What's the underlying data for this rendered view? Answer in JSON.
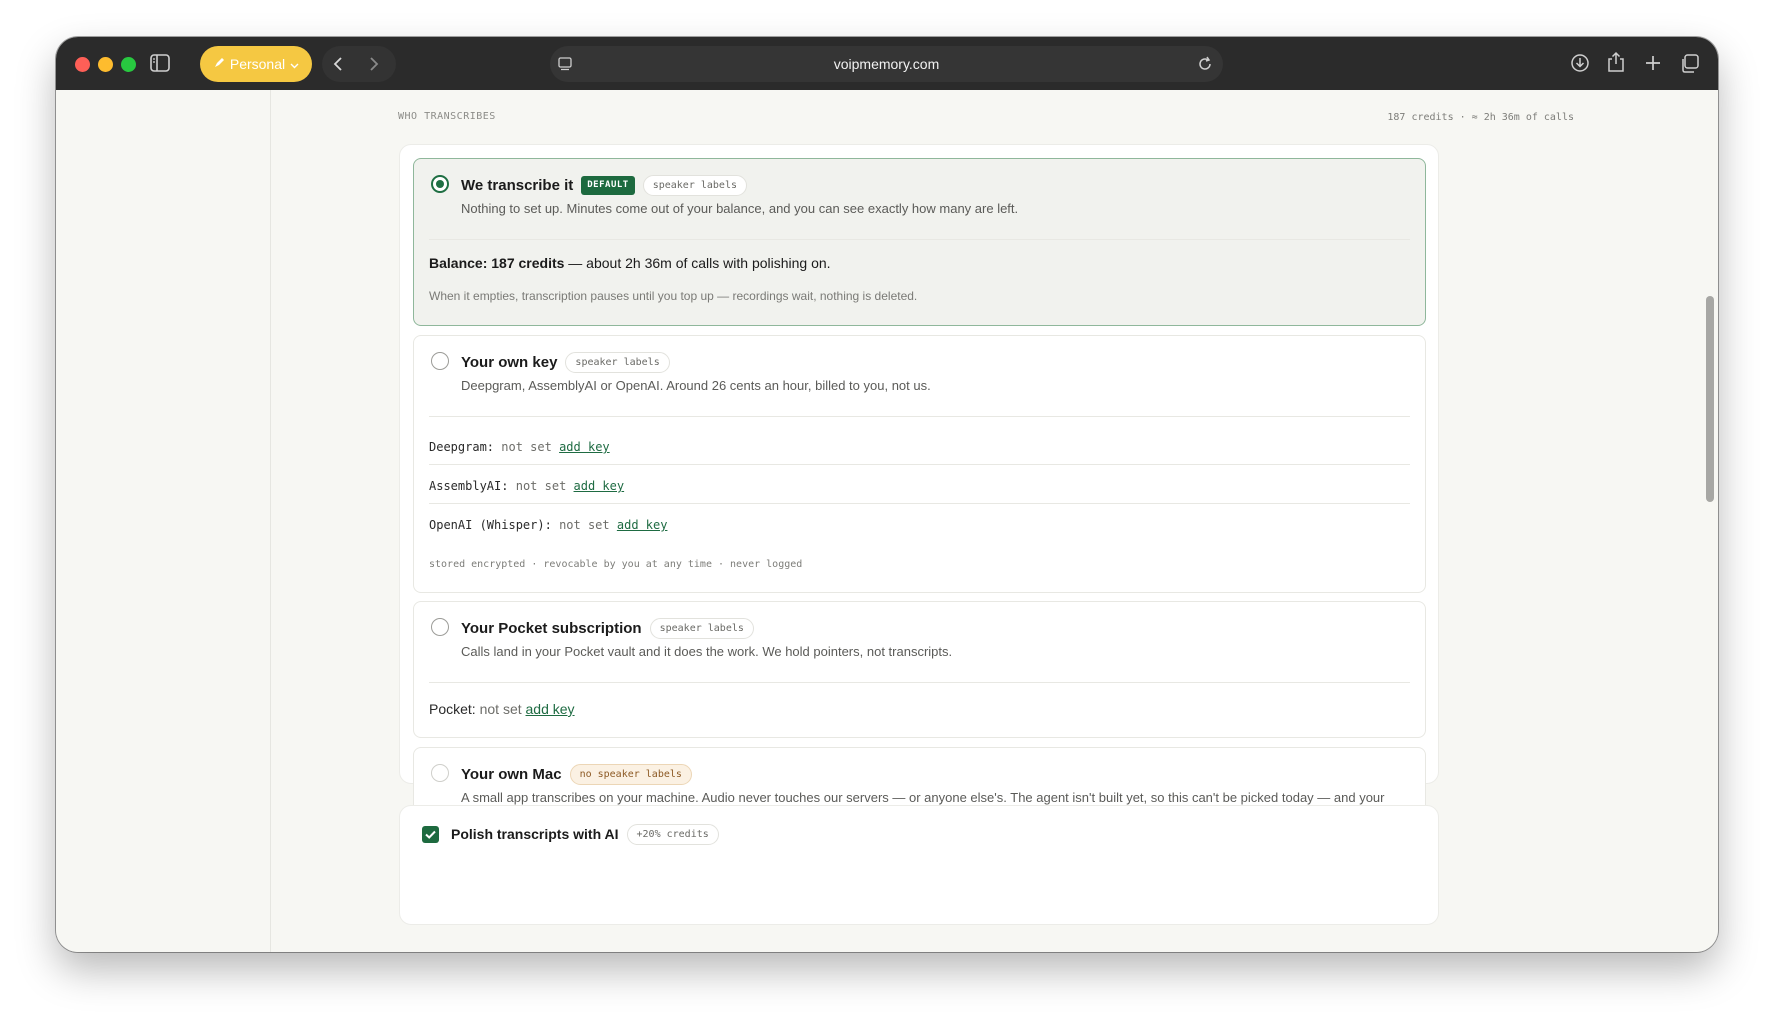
{
  "browser": {
    "profile_label": "Personal",
    "url": "voipmemory.com"
  },
  "page": {
    "section_label": "WHO TRANSCRIBES",
    "credits_summary": "187 credits · ≈ 2h 36m of calls"
  },
  "options": [
    {
      "title": "We transcribe it",
      "badge": "DEFAULT",
      "pill": "speaker labels",
      "selected": true,
      "description": "Nothing to set up. Minutes come out of your balance, and you can see exactly how many are left.",
      "balance_strong": "Balance: 187 credits",
      "balance_rest": " — about 2h 36m of calls with polishing on.",
      "note": "When it empties, transcription pauses until you top up — recordings wait, nothing is deleted."
    },
    {
      "title": "Your own key",
      "pill": "speaker labels",
      "selected": false,
      "description": "Deepgram, AssemblyAI or OpenAI. Around 26 cents an hour, billed to you, not us.",
      "keys": [
        {
          "provider": "Deepgram:",
          "status": "not set",
          "action": "add key"
        },
        {
          "provider": "AssemblyAI:",
          "status": "not set",
          "action": "add key"
        },
        {
          "provider": "OpenAI (Whisper):",
          "status": "not set",
          "action": "add key"
        }
      ],
      "footnote": "stored encrypted · revocable by you at any time · never logged"
    },
    {
      "title": "Your Pocket subscription",
      "pill": "speaker labels",
      "selected": false,
      "description": "Calls land in your Pocket vault and it does the work. We hold pointers, not transcripts.",
      "key_provider": "Pocket:",
      "key_status": "not set",
      "key_action": "add key"
    },
    {
      "title": "Your own Mac",
      "pill": "no speaker labels",
      "selected": false,
      "description": "A small app transcribes on your machine. Audio never touches our servers — or anyone else's. The agent isn't built yet, so this can't be picked today — and your Mac would need to be awake when a recording lands."
    }
  ],
  "polish": {
    "checked": true,
    "title": "Polish transcripts with AI",
    "pill": "+20% credits"
  }
}
